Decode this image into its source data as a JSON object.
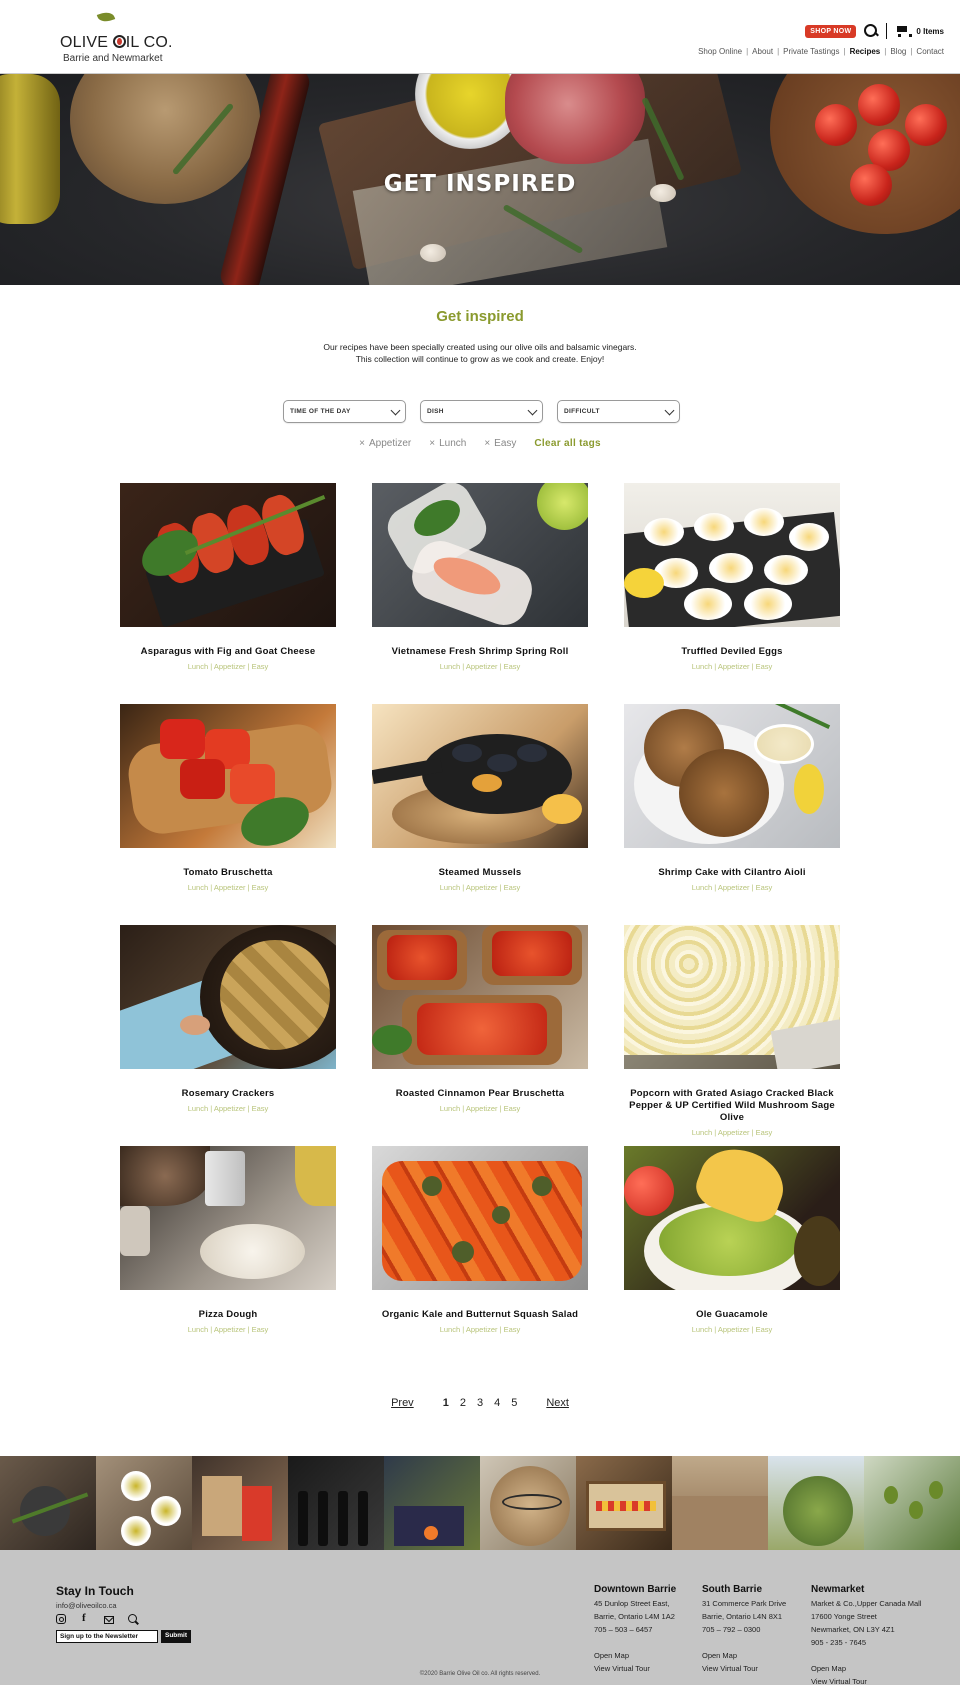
{
  "header": {
    "logo_name_1": "OLIVE ",
    "logo_name_2": "IL CO.",
    "logo_sub": "Barrie and Newmarket",
    "shop_now": "SHOP NOW",
    "cart_count": "0 Items",
    "nav": [
      "Shop Online",
      "About",
      "Private Tastings",
      "Recipes",
      "Blog",
      "Contact"
    ],
    "nav_active": "Recipes"
  },
  "hero": {
    "title": "GET INSPIRED"
  },
  "intro": {
    "title": "Get inspired",
    "line1": "Our recipes have been specially created using our olive oils and balsamic vinegars.",
    "line2": "This collection will continue to grow as we cook and create. Enjoy!"
  },
  "filters": {
    "time": "TIME OF THE DAY",
    "dish": "DISH",
    "difficulty": "DIFFICULT"
  },
  "tags": {
    "items": [
      "Appetizer",
      "Lunch",
      "Easy"
    ],
    "clear": "Clear all tags"
  },
  "recipes": [
    {
      "title": "Asparagus with Fig and Goat Cheese",
      "meta": "Lunch | Appetizer | Easy"
    },
    {
      "title": "Vietnamese Fresh Shrimp Spring Roll",
      "meta": "Lunch | Appetizer | Easy"
    },
    {
      "title": "Truffled Deviled Eggs",
      "meta": "Lunch | Appetizer | Easy"
    },
    {
      "title": "Tomato Bruschetta",
      "meta": "Lunch | Appetizer | Easy"
    },
    {
      "title": "Steamed Mussels",
      "meta": "Lunch | Appetizer | Easy"
    },
    {
      "title": "Shrimp Cake with Cilantro Aioli",
      "meta": "Lunch | Appetizer | Easy"
    },
    {
      "title": "Rosemary Crackers",
      "meta": "Lunch | Appetizer | Easy"
    },
    {
      "title": "Roasted Cinnamon Pear Bruschetta",
      "meta": "Lunch | Appetizer | Easy"
    },
    {
      "title": "Popcorn with Grated Asiago Cracked Black Pepper & UP Certified Wild Mushroom Sage Olive",
      "meta": "Lunch | Appetizer | Easy"
    },
    {
      "title": "Pizza Dough",
      "meta": "Lunch | Appetizer | Easy"
    },
    {
      "title": "Organic Kale and Butternut Squash Salad",
      "meta": "Lunch | Appetizer | Easy"
    },
    {
      "title": "Ole Guacamole",
      "meta": "Lunch | Appetizer | Easy"
    }
  ],
  "pagination": {
    "prev": "Prev",
    "pages": [
      "1",
      "2",
      "3",
      "4",
      "5"
    ],
    "current": "1",
    "next": "Next"
  },
  "footer": {
    "title": "Stay In Touch",
    "email": "info@oliveoilco.ca",
    "newsletter_placeholder": "Sign up to the Newsletter",
    "submit": "Submit",
    "locations": [
      {
        "name": "Downtown Barrie",
        "lines": [
          "45 Dunlop Street East,",
          "Barrie, Ontario L4M 1A2",
          "705 – 503 – 6457"
        ],
        "map": "Open Map",
        "tour": "View Virtual Tour"
      },
      {
        "name": "South Barrie",
        "lines": [
          "31 Commerce Park Drive",
          "Barrie, Ontario L4N 8X1",
          "705 – 792 – 0300"
        ],
        "map": "Open Map",
        "tour": "View Virtual Tour"
      },
      {
        "name": "Newmarket",
        "lines": [
          "Market & Co.,Upper Canada Mall",
          "17600 Yonge Street",
          "Newmarket, ON L3Y 4Z1",
          "905 - 235 - 7645"
        ],
        "map": "Open Map",
        "tour": "View Virtual Tour"
      }
    ],
    "copyright": "©2020 Barrie Olive Oil co. All rights reserved."
  },
  "colors": {
    "accent_green": "#8a9a2e",
    "shop_red": "#d83a26",
    "meta_green": "#b8c47a",
    "footer_bg": "#c5c5c5"
  }
}
